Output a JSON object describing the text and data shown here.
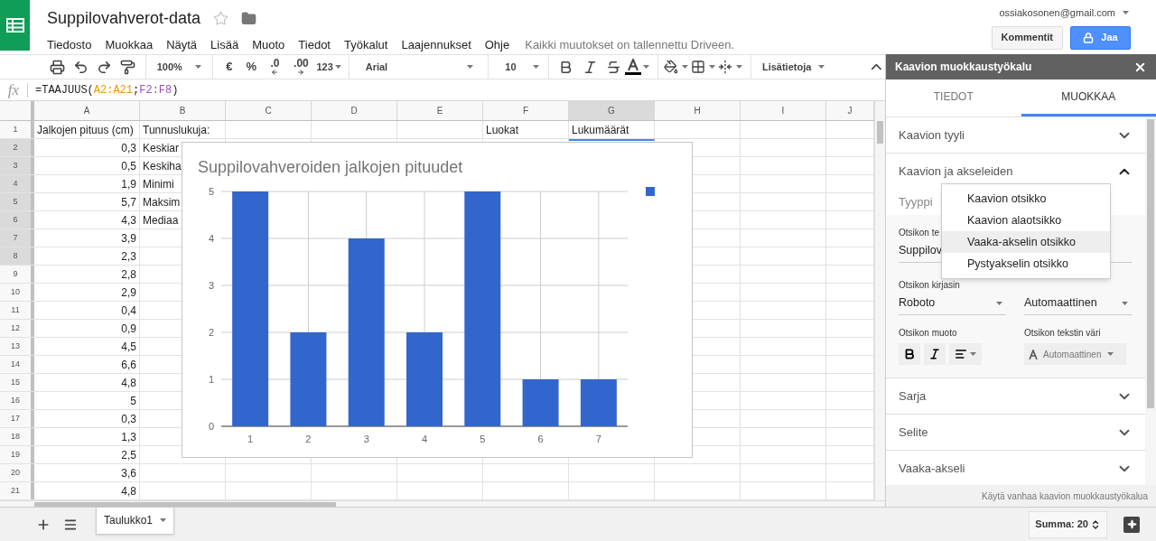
{
  "header": {
    "title": "Suppilovahverot-data",
    "starred": false,
    "menu": [
      "Tiedosto",
      "Muokkaa",
      "Näytä",
      "Lisää",
      "Muoto",
      "Tiedot",
      "Työkalut",
      "Laajennukset",
      "Ohje"
    ],
    "save_status": "Kaikki muutokset on tallennettu Driveen.",
    "account": "ossiakosonen@gmail.com",
    "comments_button": "Kommentit",
    "share_button": "Jaa"
  },
  "toolbar": {
    "zoom": "100%",
    "currency": "€",
    "percent": "%",
    "decrease_decimals": ".0",
    "increase_decimals": ".00",
    "number_format": "123",
    "font": "Arial",
    "font_size": "10",
    "more": "Lisätietoja"
  },
  "formula_bar": {
    "label": "fx",
    "parts": [
      {
        "text": "=TAAJUUS("
      },
      {
        "text": "A2:A21",
        "color": "#f09300"
      },
      {
        "text": ";"
      },
      {
        "text": "F2:F8",
        "color": "#9c4dc0"
      },
      {
        "text": ")"
      }
    ]
  },
  "columns": [
    {
      "label": "A",
      "selected": false
    },
    {
      "label": "B",
      "selected": false
    },
    {
      "label": "C",
      "selected": false
    },
    {
      "label": "D",
      "selected": false
    },
    {
      "label": "E",
      "selected": false
    },
    {
      "label": "F",
      "selected": false
    },
    {
      "label": "G",
      "selected": true
    },
    {
      "label": "H",
      "selected": false
    },
    {
      "label": "I",
      "selected": false
    },
    {
      "label": "J",
      "selected": false
    }
  ],
  "rows": [
    {
      "label": "1",
      "selected": false,
      "kind": "heading",
      "a": "Jalkojen pituus (cm)",
      "b": "Tunnuslukuja:",
      "f": "Luokat",
      "g": "Lukumäärät"
    },
    {
      "label": "2",
      "selected": true,
      "kind": "data",
      "a": "0,3",
      "b": "Keskiar"
    },
    {
      "label": "3",
      "selected": true,
      "kind": "data",
      "a": "0,5",
      "b": "Keskiha"
    },
    {
      "label": "4",
      "selected": true,
      "kind": "data",
      "a": "1,9",
      "b": "Minimi"
    },
    {
      "label": "5",
      "selected": true,
      "kind": "data",
      "a": "5,7",
      "b": "Maksim"
    },
    {
      "label": "6",
      "selected": true,
      "kind": "data",
      "a": "4,3",
      "b": "Mediaa"
    },
    {
      "label": "7",
      "selected": true,
      "kind": "data",
      "a": "3,9"
    },
    {
      "label": "8",
      "selected": true,
      "kind": "data",
      "a": "2,3"
    },
    {
      "label": "9",
      "selected": false,
      "kind": "data",
      "a": "2,8"
    },
    {
      "label": "10",
      "selected": false,
      "kind": "data",
      "a": "2,9"
    },
    {
      "label": "11",
      "selected": false,
      "kind": "data",
      "a": "0,4"
    },
    {
      "label": "12",
      "selected": false,
      "kind": "data",
      "a": "0,9"
    },
    {
      "label": "13",
      "selected": false,
      "kind": "data",
      "a": "4,5"
    },
    {
      "label": "14",
      "selected": false,
      "kind": "data",
      "a": "6,6"
    },
    {
      "label": "15",
      "selected": false,
      "kind": "data",
      "a": "4,8"
    },
    {
      "label": "16",
      "selected": false,
      "kind": "data",
      "a": "5"
    },
    {
      "label": "17",
      "selected": false,
      "kind": "data",
      "a": "0,3"
    },
    {
      "label": "18",
      "selected": false,
      "kind": "data",
      "a": "1,3"
    },
    {
      "label": "19",
      "selected": false,
      "kind": "data",
      "a": "2,5"
    },
    {
      "label": "20",
      "selected": false,
      "kind": "data",
      "a": "3,6"
    },
    {
      "label": "21",
      "selected": false,
      "kind": "data",
      "a": "4,8"
    }
  ],
  "chart": {
    "chart_data": {
      "type": "bar",
      "title": "Suppilovahveroiden jalkojen pituudet",
      "categories": [
        "1",
        "2",
        "3",
        "4",
        "5",
        "6",
        "7"
      ],
      "series": [
        {
          "color": "#3366cc",
          "values": [
            5,
            2,
            4,
            2,
            5,
            1,
            1
          ]
        }
      ],
      "ylim": [
        0,
        5
      ],
      "yticks": [
        0,
        1,
        2,
        3,
        4,
        5
      ],
      "grid": true
    }
  },
  "sheet_tabs": [
    {
      "label": "Taulukko1",
      "selected": true
    }
  ],
  "status": {
    "sum": "Summa: 20"
  },
  "editor": {
    "title": "Kaavion muokkaustyökalu",
    "tabs": [
      {
        "label": "TIEDOT",
        "selected": false
      },
      {
        "label": "MUOKKAA",
        "selected": true
      }
    ],
    "sections": [
      {
        "label": "Kaavion tyyli",
        "expanded": false
      },
      {
        "label": "Kaavion ja akseleiden",
        "expanded": true
      },
      {
        "label": "Sarja",
        "expanded": false
      },
      {
        "label": "Selite",
        "expanded": false
      },
      {
        "label": "Vaaka-akseli",
        "expanded": false
      }
    ],
    "title_settings": {
      "type_label": "Tyyppi",
      "text_label": "Otsikon te",
      "text_value": "Suppilov",
      "font_label": "Otsikon kirjasin",
      "font_value": "Roboto",
      "size_value": "Automaattinen",
      "format_label": "Otsikon muoto",
      "color_label": "Otsikon tekstin väri",
      "color_value": "Automaattinen"
    },
    "type_menu": [
      {
        "label": "Kaavion otsikko",
        "selected": false
      },
      {
        "label": "Kaavion alaotsikko",
        "selected": false
      },
      {
        "label": "Vaaka-akselin otsikko",
        "selected": true
      },
      {
        "label": "Pystyakselin otsikko",
        "selected": false
      }
    ],
    "footer_link": "Käytä vanhaa kaavion muokkaustyökalua"
  }
}
